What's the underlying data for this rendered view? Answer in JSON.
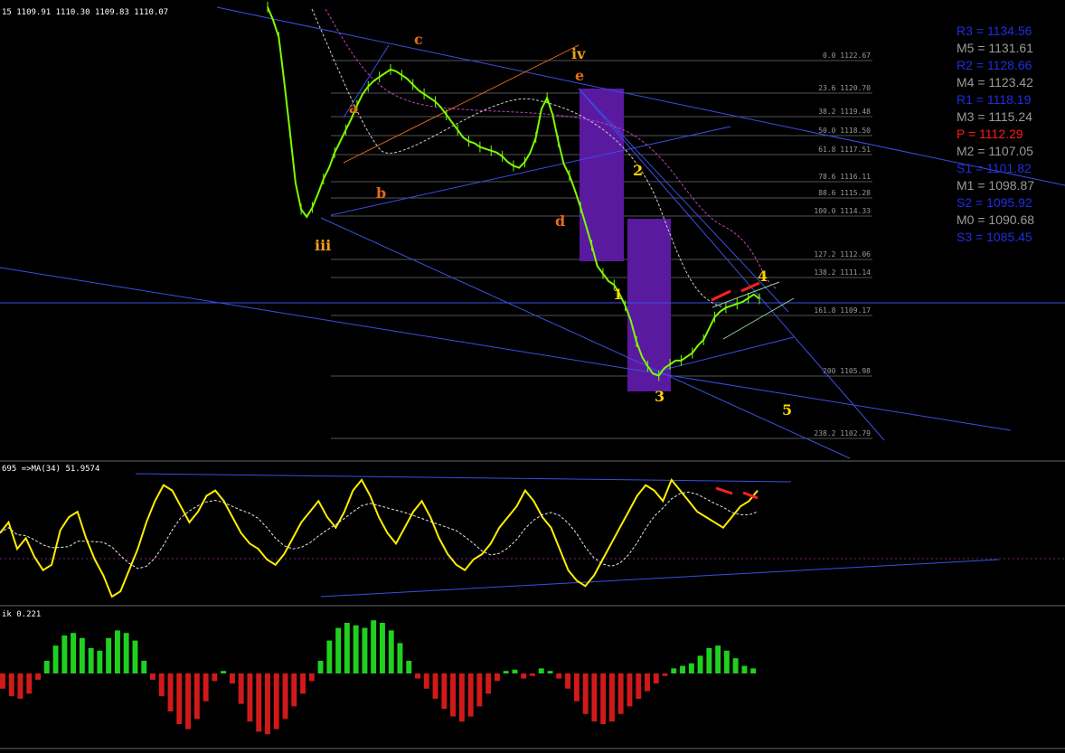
{
  "header": {
    "main": "15  1109.91 1110.30 1109.83 1110.07",
    "stoch": "695  =>MA(34) 51.9574",
    "hist": "ik 0.221"
  },
  "colors": {
    "bg": "#000000",
    "candle": "#7cfc00",
    "trend": "#3a4fe0",
    "wave_orange": "#e86a1a",
    "wave_yellow": "#ffd400",
    "box": "#5a1aa0",
    "osc": "#ffee00",
    "hist_up": "#1fd11f",
    "hist_down": "#d01a1a",
    "fib": "#555555"
  },
  "waves": [
    {
      "text": "iii",
      "color": "orange"
    },
    {
      "text": "a",
      "color": "red"
    },
    {
      "text": "b",
      "color": "red"
    },
    {
      "text": "c",
      "color": "red"
    },
    {
      "text": "d",
      "color": "red"
    },
    {
      "text": "e",
      "color": "red"
    },
    {
      "text": "iv",
      "color": "orange"
    },
    {
      "text": "1",
      "color": "yellow"
    },
    {
      "text": "2",
      "color": "yellow"
    },
    {
      "text": "3",
      "color": "yellow"
    },
    {
      "text": "4",
      "color": "yellow"
    },
    {
      "text": "5",
      "color": "yellow"
    }
  ],
  "fib_levels": [
    {
      "label": "0.0  1122.67"
    },
    {
      "label": "23.6  1120.70"
    },
    {
      "label": "38.2  1119.48"
    },
    {
      "label": "50.0  1118.50"
    },
    {
      "label": "61.8  1117.51"
    },
    {
      "label": "78.6  1116.11"
    },
    {
      "label": "88.6  1115.28"
    },
    {
      "label": "100.0  1114.33"
    },
    {
      "label": "127.2  1112.06"
    },
    {
      "label": "138.2  1111.14"
    },
    {
      "label": "161.8  1109.17"
    },
    {
      "label": "200  1105.98"
    },
    {
      "label": "238.2  1102.79"
    }
  ],
  "pivots": [
    {
      "label": "R3 = 1134.56",
      "color": "#1f2ee0"
    },
    {
      "label": "M5 = 1131.61",
      "color": "#9a9a9a"
    },
    {
      "label": "R2 = 1128.66",
      "color": "#1f2ee0"
    },
    {
      "label": "M4 = 1123.42",
      "color": "#9a9a9a"
    },
    {
      "label": "R1 = 1118.19",
      "color": "#1f2ee0"
    },
    {
      "label": "M3 = 1115.24",
      "color": "#9a9a9a"
    },
    {
      "label": "P  = 1112.29",
      "color": "#ff1a1a"
    },
    {
      "label": "M2 = 1107.05",
      "color": "#9a9a9a"
    },
    {
      "label": "S1 = 1101.82",
      "color": "#1f2ee0"
    },
    {
      "label": "M1 = 1098.87",
      "color": "#9a9a9a"
    },
    {
      "label": "S2 = 1095.92",
      "color": "#1f2ee0"
    },
    {
      "label": "M0 = 1090.68",
      "color": "#9a9a9a"
    },
    {
      "label": "S3 = 1085.45",
      "color": "#1f2ee0"
    }
  ],
  "chart_data": [
    {
      "type": "line",
      "title": "price",
      "close": [
        1125.5,
        1124.8,
        1123.9,
        1121.5,
        1118.9,
        1116.2,
        1114.8,
        1114.4,
        1114.9,
        1115.6,
        1116.4,
        1117.0,
        1117.8,
        1118.4,
        1119.0,
        1119.6,
        1120.3,
        1120.9,
        1121.3,
        1121.6,
        1121.8,
        1122.0,
        1122.2,
        1122.1,
        1121.9,
        1121.7,
        1121.4,
        1121.1,
        1120.9,
        1120.7,
        1120.5,
        1120.2,
        1119.8,
        1119.4,
        1119.0,
        1118.6,
        1118.4,
        1118.3,
        1118.1,
        1118.0,
        1117.9,
        1117.8,
        1117.6,
        1117.3,
        1117.1,
        1117.0,
        1117.3,
        1117.8,
        1118.6,
        1120.1,
        1120.7,
        1119.8,
        1118.4,
        1117.2,
        1116.6,
        1115.8,
        1114.9,
        1113.9,
        1112.9,
        1111.8,
        1111.4,
        1111.0,
        1110.8,
        1110.3,
        1109.7,
        1108.9,
        1107.8,
        1107.0,
        1106.5,
        1106.1,
        1106.0,
        1106.4,
        1106.6,
        1106.8,
        1106.8,
        1107.0,
        1107.2,
        1107.6,
        1107.9,
        1108.5,
        1109.1,
        1109.4,
        1109.6,
        1109.7,
        1109.8,
        1109.9,
        1110.1,
        1110.3,
        1110.07
      ]
    },
    {
      "type": "line",
      "title": "oscillator",
      "values": [
        54,
        58,
        48,
        52,
        45,
        40,
        42,
        55,
        60,
        62,
        52,
        44,
        38,
        30,
        32,
        40,
        48,
        58,
        66,
        72,
        70,
        64,
        58,
        62,
        68,
        70,
        66,
        60,
        54,
        50,
        48,
        44,
        42,
        46,
        52,
        58,
        62,
        66,
        60,
        56,
        62,
        70,
        74,
        68,
        60,
        54,
        50,
        56,
        62,
        66,
        60,
        52,
        46,
        42,
        40,
        44,
        46,
        50,
        56,
        60,
        64,
        70,
        66,
        60,
        56,
        48,
        40,
        36,
        34,
        38,
        44,
        50,
        56,
        62,
        68,
        72,
        70,
        66,
        74,
        70,
        66,
        62,
        60,
        58,
        56,
        60,
        64,
        66,
        70
      ]
    },
    {
      "type": "bar",
      "title": "histogram",
      "values": [
        -0.12,
        -0.18,
        -0.2,
        -0.16,
        -0.05,
        0.1,
        0.22,
        0.3,
        0.32,
        0.28,
        0.2,
        0.18,
        0.28,
        0.34,
        0.32,
        0.26,
        0.1,
        -0.05,
        -0.18,
        -0.3,
        -0.4,
        -0.44,
        -0.36,
        -0.22,
        -0.06,
        0.02,
        -0.08,
        -0.24,
        -0.38,
        -0.46,
        -0.48,
        -0.44,
        -0.36,
        -0.26,
        -0.16,
        -0.06,
        0.1,
        0.26,
        0.36,
        0.4,
        0.38,
        0.36,
        0.42,
        0.4,
        0.34,
        0.24,
        0.1,
        -0.04,
        -0.12,
        -0.2,
        -0.28,
        -0.34,
        -0.38,
        -0.34,
        -0.26,
        -0.16,
        -0.06,
        0.02,
        0.03,
        -0.04,
        -0.02,
        0.04,
        0.02,
        -0.04,
        -0.12,
        -0.22,
        -0.32,
        -0.38,
        -0.4,
        -0.38,
        -0.32,
        -0.26,
        -0.2,
        -0.14,
        -0.08,
        -0.02,
        0.04,
        0.06,
        0.08,
        0.14,
        0.2,
        0.22,
        0.18,
        0.12,
        0.06,
        0.04
      ]
    }
  ]
}
